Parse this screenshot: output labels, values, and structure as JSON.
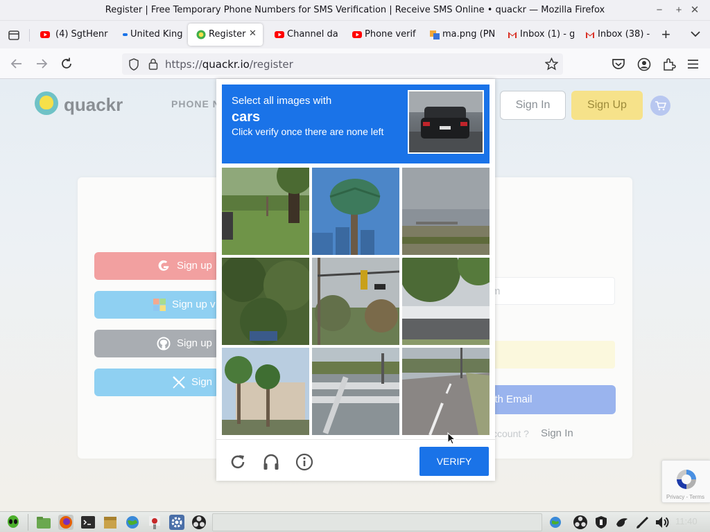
{
  "window": {
    "title": "Register | Free Temporary Phone Numbers for SMS Verification | Receive SMS Online • quackr — Mozilla Firefox"
  },
  "tabs": [
    {
      "label": "(4) SgtHenr",
      "icon": "youtube-icon"
    },
    {
      "label": "United King",
      "icon": "site-icon"
    },
    {
      "label": "Register",
      "icon": "quackr-icon",
      "active": true
    },
    {
      "label": "Channel da",
      "icon": "youtube-icon"
    },
    {
      "label": "Phone verif",
      "icon": "youtube-icon"
    },
    {
      "label": "ma.png (PN",
      "icon": "image-icon"
    },
    {
      "label": "Inbox (1) - g",
      "icon": "gmail-icon"
    },
    {
      "label": "Inbox (38) -",
      "icon": "gmail-icon"
    }
  ],
  "address_bar": {
    "url_prefix": "https://",
    "url_domain": "quackr.io",
    "url_path": "/register"
  },
  "site": {
    "logo_text": "quackr",
    "nav_link": "PHONE N",
    "sign_in": "Sign In",
    "sign_up": "Sign Up",
    "social": [
      {
        "label": "Sign up",
        "color": "#f2a0a0",
        "icon": "google-icon"
      },
      {
        "label": "Sign up v",
        "color": "#8fd0f2",
        "icon": "microsoft-icon"
      },
      {
        "label": "Sign up",
        "color": "#a9adb2",
        "icon": "github-icon"
      },
      {
        "label": "Sign",
        "color": "#8fd0f2",
        "icon": "x-icon"
      }
    ],
    "email_placeholder": "m",
    "email_button": "ith Email",
    "have_account": "ccount ?",
    "have_account_link": "Sign In"
  },
  "recaptcha_badge": {
    "note": "Privacy - Terms"
  },
  "captcha": {
    "prompt_line1": "Select all images with",
    "target": "cars",
    "instruction": "Click verify once there are none left",
    "accent": "#1a73e8",
    "tiles": [
      {
        "desc": "park-lawn"
      },
      {
        "desc": "palm-tree"
      },
      {
        "desc": "noisy-shore"
      },
      {
        "desc": "trees"
      },
      {
        "desc": "traffic-light"
      },
      {
        "desc": "building"
      },
      {
        "desc": "palms-house"
      },
      {
        "desc": "crosswalk"
      },
      {
        "desc": "road"
      }
    ],
    "verify_label": "VERIFY"
  },
  "taskbar": {
    "clock": "11:40"
  }
}
